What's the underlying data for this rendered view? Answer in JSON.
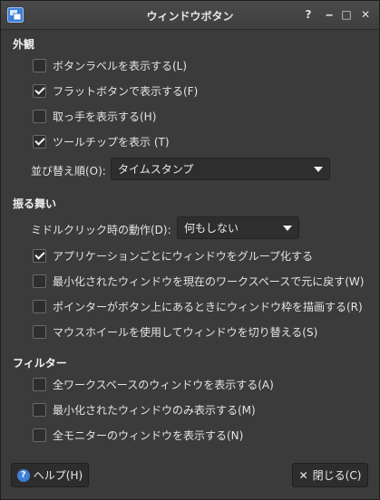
{
  "window": {
    "title": "ウィンドウボタン",
    "controls": {
      "help": "?",
      "minimize": "‒",
      "maximize": "□",
      "close": "✕"
    }
  },
  "appearance": {
    "heading": "外観",
    "options": [
      {
        "label": "ボタンラベルを表示する(L)",
        "checked": false
      },
      {
        "label": "フラットボタンで表示する(F)",
        "checked": true
      },
      {
        "label": "取っ手を表示する(H)",
        "checked": false
      },
      {
        "label": "ツールチップを表示 (T)",
        "checked": true
      }
    ],
    "sort_label": "並び替え順(O):",
    "sort_value": "タイムスタンプ"
  },
  "behavior": {
    "heading": "振る舞い",
    "middle_click_label": "ミドルクリック時の動作(D):",
    "middle_click_value": "何もしない",
    "options": [
      {
        "label": "アプリケーションごとにウィンドウをグループ化する",
        "checked": true
      },
      {
        "label": "最小化されたウィンドウを現在のワークスペースで元に戻す(W)",
        "checked": false
      },
      {
        "label": "ポインターがボタン上にあるときにウィンドウ枠を描画する(R)",
        "checked": false
      },
      {
        "label": "マウスホイールを使用してウィンドウを切り替える(S)",
        "checked": false
      }
    ]
  },
  "filter": {
    "heading": "フィルター",
    "options": [
      {
        "label": "全ワークスペースのウィンドウを表示する(A)",
        "checked": false
      },
      {
        "label": "最小化されたウィンドウのみ表示する(M)",
        "checked": false
      },
      {
        "label": "全モニターのウィンドウを表示する(N)",
        "checked": false
      }
    ]
  },
  "footer": {
    "help_label": "ヘルプ(H)",
    "help_icon": "?",
    "close_label": "閉じる(C)",
    "close_icon": "✕"
  }
}
